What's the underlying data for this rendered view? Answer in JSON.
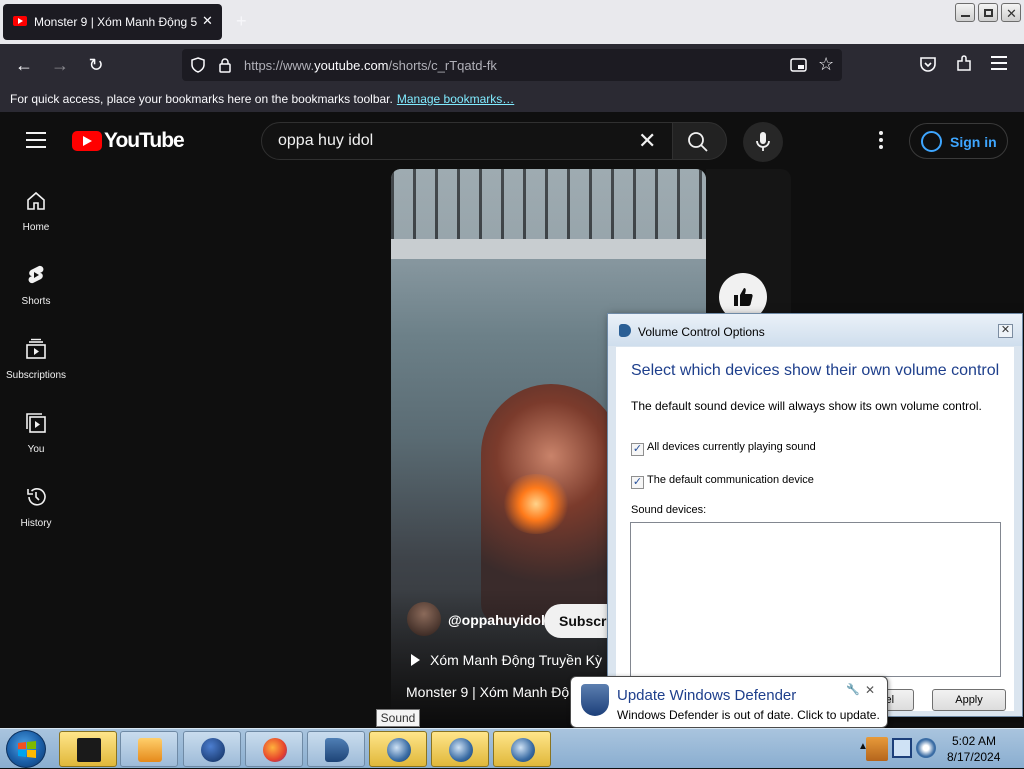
{
  "browser": {
    "tab_title": "Monster 9 | Xóm Manh Động 5",
    "tab_close": "✕",
    "new_tab": "+",
    "url_prefix": "https://www.",
    "url_domain": "youtube.com",
    "url_path": "/shorts/c_rTqatd-fk",
    "bookmarks_message": "For quick access, place your bookmarks here on the bookmarks toolbar.",
    "bookmarks_link": "Manage bookmarks…"
  },
  "youtube": {
    "logo_text": "YouTube",
    "search_value": "oppa huy idol",
    "sign_in": "Sign in",
    "sidebar": [
      {
        "label": "Home"
      },
      {
        "label": "Shorts"
      },
      {
        "label": "Subscriptions"
      },
      {
        "label": "You"
      },
      {
        "label": "History"
      }
    ],
    "short": {
      "channel": "@oppahuyidol",
      "subscribe": "Subscribe",
      "playlist": "Xóm Manh Động Truyền Kỳ |",
      "title": "Monster 9 | Xóm Manh Độ"
    }
  },
  "dialog": {
    "title": "Volume Control Options",
    "close": "✕",
    "heading": "Select which devices show their own volume control",
    "description": "The default sound device will always show its own volume control.",
    "options": [
      {
        "label": "All devices currently playing sound",
        "checked": true
      },
      {
        "label": "The default communication device",
        "checked": true
      }
    ],
    "sound_devices_label": "Sound devices:",
    "cancel": "Cancel",
    "apply": "Apply"
  },
  "notification": {
    "title": "Update Windows Defender",
    "text": "Windows Defender is out of date. Click to update.",
    "close": "✕"
  },
  "tooltip": "Sound",
  "clock": {
    "time": "5:02 AM",
    "date": "8/17/2024"
  },
  "colors": {
    "youtube_red": "#ff0000",
    "link_blue": "#3ea6ff",
    "dialog_heading": "#1e3f8c"
  }
}
